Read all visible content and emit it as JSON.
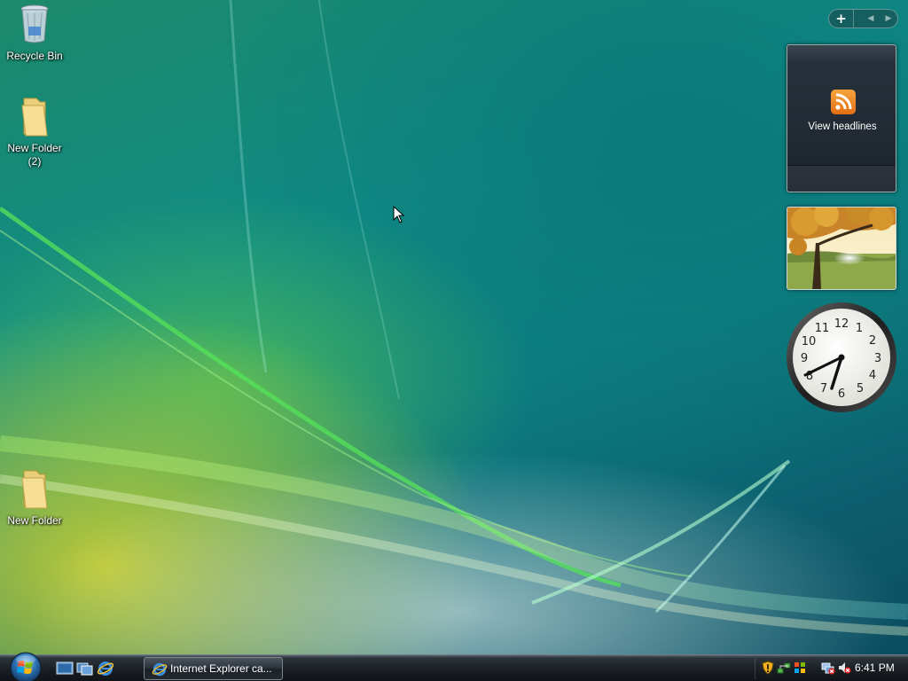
{
  "desktop": {
    "icons": [
      {
        "label": "Recycle Bin",
        "icon": "recycle-bin-icon"
      },
      {
        "label": "New Folder\n(2)",
        "icon": "folder-icon"
      },
      {
        "label": "New Folder",
        "icon": "folder-icon"
      }
    ]
  },
  "sidebar": {
    "add_label": "+",
    "prev_label": "◀",
    "next_label": "▶",
    "feed": {
      "label": "View headlines",
      "icon": "rss-icon"
    },
    "slideshow": {
      "icon": "photo-icon"
    },
    "clock": {
      "icon": "analog-clock",
      "time": "6:41"
    }
  },
  "taskbar": {
    "start": {
      "icon": "windows-start-orb"
    },
    "quick_launch": [
      {
        "icon": "show-desktop-icon"
      },
      {
        "icon": "switch-windows-icon"
      },
      {
        "icon": "internet-explorer-icon"
      }
    ],
    "windows": [
      {
        "label": "Internet Explorer ca...",
        "icon": "internet-explorer-icon"
      }
    ],
    "tray": {
      "icons": [
        "security-shield-icon",
        "network-icon",
        "windows-update-icon",
        "network-disconnected-icon",
        "volume-muted-icon"
      ],
      "time": "6:41 PM"
    }
  }
}
